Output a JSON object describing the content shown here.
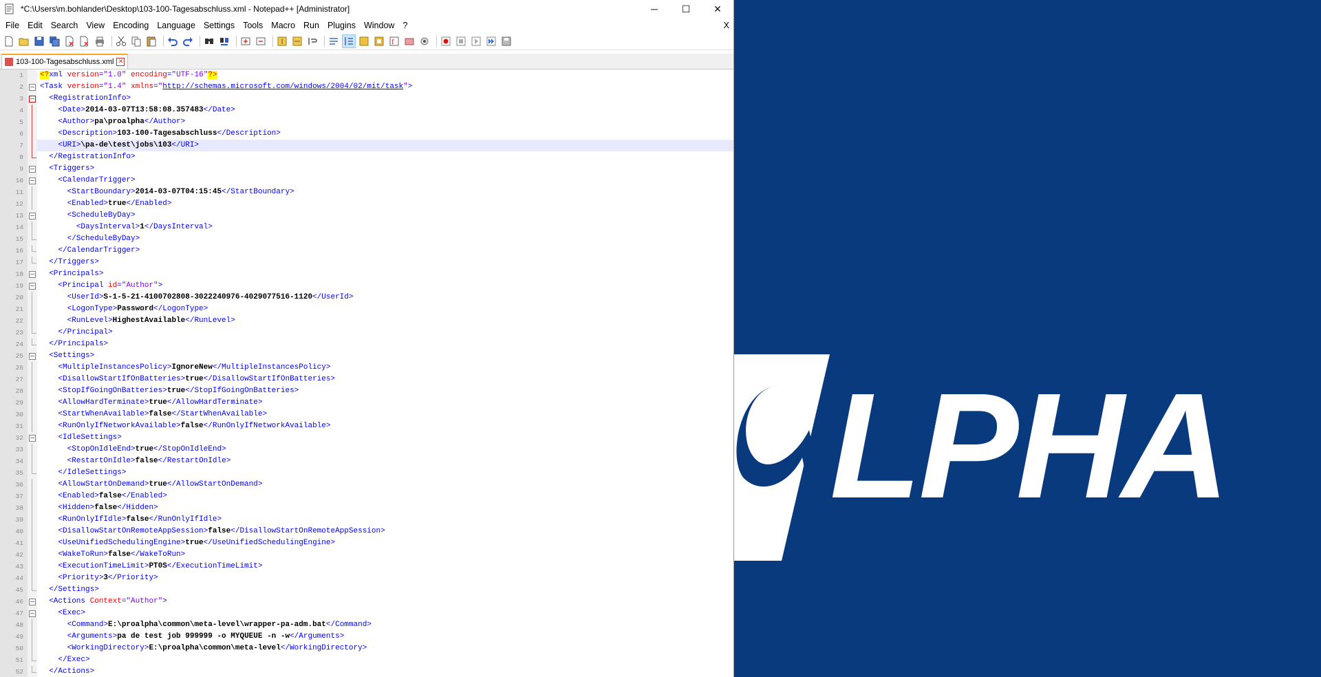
{
  "window": {
    "title": "*C:\\Users\\m.bohlander\\Desktop\\103-100-Tagesabschluss.xml - Notepad++ [Administrator]",
    "minimize": "─",
    "maximize": "☐",
    "close": "✕"
  },
  "menu": {
    "items": [
      "File",
      "Edit",
      "Search",
      "View",
      "Encoding",
      "Language",
      "Settings",
      "Tools",
      "Macro",
      "Run",
      "Plugins",
      "Window",
      "?"
    ],
    "close_doc": "X"
  },
  "tabs": [
    {
      "label": "103-100-Tagesabschluss.xml",
      "close": "✕"
    }
  ],
  "editor": {
    "current_line": 7,
    "lines": [
      {
        "n": "1",
        "fold": "none",
        "segs": [
          [
            "hl",
            "<?"
          ],
          [
            "t",
            "xml "
          ],
          [
            "a",
            "version"
          ],
          [
            "t",
            "="
          ],
          [
            "v",
            "\"1.0\""
          ],
          [
            "t",
            " "
          ],
          [
            "a",
            "encoding"
          ],
          [
            "t",
            "="
          ],
          [
            "v",
            "\"UTF-16\""
          ],
          [
            "hl",
            "?>"
          ]
        ]
      },
      {
        "n": "2",
        "fold": "open",
        "segs": [
          [
            "t",
            "<Task "
          ],
          [
            "a",
            "version"
          ],
          [
            "t",
            "="
          ],
          [
            "v",
            "\"1.4\""
          ],
          [
            "t",
            " "
          ],
          [
            "a",
            "xmlns"
          ],
          [
            "t",
            "="
          ],
          [
            "v",
            "\""
          ],
          [
            "u",
            "http://schemas.microsoft.com/windows/2004/02/mit/task"
          ],
          [
            "v",
            "\""
          ],
          [
            "t",
            ">"
          ]
        ]
      },
      {
        "n": "3",
        "fold": "open-red",
        "segs": [
          [
            "i",
            "  "
          ],
          [
            "t",
            "<RegistrationInfo>"
          ]
        ]
      },
      {
        "n": "4",
        "fold": "line-red",
        "segs": [
          [
            "i",
            "    "
          ],
          [
            "t",
            "<Date>"
          ],
          [
            "x",
            "2014-03-07T13:58:08.357483"
          ],
          [
            "t",
            "</Date>"
          ]
        ]
      },
      {
        "n": "5",
        "fold": "line-red",
        "segs": [
          [
            "i",
            "    "
          ],
          [
            "t",
            "<Author>"
          ],
          [
            "x",
            "pa\\proalpha"
          ],
          [
            "t",
            "</Author>"
          ]
        ]
      },
      {
        "n": "6",
        "fold": "line-red",
        "segs": [
          [
            "i",
            "    "
          ],
          [
            "t",
            "<Description>"
          ],
          [
            "x",
            "103-100-Tagesabschluss"
          ],
          [
            "t",
            "</Description>"
          ]
        ]
      },
      {
        "n": "7",
        "fold": "line-red",
        "segs": [
          [
            "i",
            "    "
          ],
          [
            "t",
            "<URI>"
          ],
          [
            "x",
            "\\pa-de\\test\\jobs\\103"
          ],
          [
            "t",
            "</URI>"
          ]
        ]
      },
      {
        "n": "8",
        "fold": "end-red",
        "segs": [
          [
            "i",
            "  "
          ],
          [
            "t",
            "</RegistrationInfo>"
          ]
        ]
      },
      {
        "n": "9",
        "fold": "open",
        "segs": [
          [
            "i",
            "  "
          ],
          [
            "t",
            "<Triggers>"
          ]
        ]
      },
      {
        "n": "10",
        "fold": "open",
        "segs": [
          [
            "i",
            "    "
          ],
          [
            "t",
            "<CalendarTrigger>"
          ]
        ]
      },
      {
        "n": "11",
        "fold": "line",
        "segs": [
          [
            "i",
            "      "
          ],
          [
            "t",
            "<StartBoundary>"
          ],
          [
            "x",
            "2014-03-07T04:15:45"
          ],
          [
            "t",
            "</StartBoundary>"
          ]
        ]
      },
      {
        "n": "12",
        "fold": "line",
        "segs": [
          [
            "i",
            "      "
          ],
          [
            "t",
            "<Enabled>"
          ],
          [
            "x",
            "true"
          ],
          [
            "t",
            "</Enabled>"
          ]
        ]
      },
      {
        "n": "13",
        "fold": "open",
        "segs": [
          [
            "i",
            "      "
          ],
          [
            "t",
            "<ScheduleByDay>"
          ]
        ]
      },
      {
        "n": "14",
        "fold": "line",
        "segs": [
          [
            "i",
            "        "
          ],
          [
            "t",
            "<DaysInterval>"
          ],
          [
            "x",
            "1"
          ],
          [
            "t",
            "</DaysInterval>"
          ]
        ]
      },
      {
        "n": "15",
        "fold": "end",
        "segs": [
          [
            "i",
            "      "
          ],
          [
            "t",
            "</ScheduleByDay>"
          ]
        ]
      },
      {
        "n": "16",
        "fold": "end",
        "segs": [
          [
            "i",
            "    "
          ],
          [
            "t",
            "</CalendarTrigger>"
          ]
        ]
      },
      {
        "n": "17",
        "fold": "end",
        "segs": [
          [
            "i",
            "  "
          ],
          [
            "t",
            "</Triggers>"
          ]
        ]
      },
      {
        "n": "18",
        "fold": "open",
        "segs": [
          [
            "i",
            "  "
          ],
          [
            "t",
            "<Principals>"
          ]
        ]
      },
      {
        "n": "19",
        "fold": "open",
        "segs": [
          [
            "i",
            "    "
          ],
          [
            "t",
            "<Principal "
          ],
          [
            "a",
            "id"
          ],
          [
            "t",
            "="
          ],
          [
            "v",
            "\"Author\""
          ],
          [
            "t",
            ">"
          ]
        ]
      },
      {
        "n": "20",
        "fold": "line",
        "segs": [
          [
            "i",
            "      "
          ],
          [
            "t",
            "<UserId>"
          ],
          [
            "x",
            "S-1-5-21-4100702808-3022240976-4029077516-1120"
          ],
          [
            "t",
            "</UserId>"
          ]
        ]
      },
      {
        "n": "21",
        "fold": "line",
        "segs": [
          [
            "i",
            "      "
          ],
          [
            "t",
            "<LogonType>"
          ],
          [
            "x",
            "Password"
          ],
          [
            "t",
            "</LogonType>"
          ]
        ]
      },
      {
        "n": "22",
        "fold": "line",
        "segs": [
          [
            "i",
            "      "
          ],
          [
            "t",
            "<RunLevel>"
          ],
          [
            "x",
            "HighestAvailable"
          ],
          [
            "t",
            "</RunLevel>"
          ]
        ]
      },
      {
        "n": "23",
        "fold": "end",
        "segs": [
          [
            "i",
            "    "
          ],
          [
            "t",
            "</Principal>"
          ]
        ]
      },
      {
        "n": "24",
        "fold": "end",
        "segs": [
          [
            "i",
            "  "
          ],
          [
            "t",
            "</Principals>"
          ]
        ]
      },
      {
        "n": "25",
        "fold": "open",
        "segs": [
          [
            "i",
            "  "
          ],
          [
            "t",
            "<Settings>"
          ]
        ]
      },
      {
        "n": "26",
        "fold": "line",
        "segs": [
          [
            "i",
            "    "
          ],
          [
            "t",
            "<MultipleInstancesPolicy>"
          ],
          [
            "x",
            "IgnoreNew"
          ],
          [
            "t",
            "</MultipleInstancesPolicy>"
          ]
        ]
      },
      {
        "n": "27",
        "fold": "line",
        "segs": [
          [
            "i",
            "    "
          ],
          [
            "t",
            "<DisallowStartIfOnBatteries>"
          ],
          [
            "x",
            "true"
          ],
          [
            "t",
            "</DisallowStartIfOnBatteries>"
          ]
        ]
      },
      {
        "n": "28",
        "fold": "line",
        "segs": [
          [
            "i",
            "    "
          ],
          [
            "t",
            "<StopIfGoingOnBatteries>"
          ],
          [
            "x",
            "true"
          ],
          [
            "t",
            "</StopIfGoingOnBatteries>"
          ]
        ]
      },
      {
        "n": "29",
        "fold": "line",
        "segs": [
          [
            "i",
            "    "
          ],
          [
            "t",
            "<AllowHardTerminate>"
          ],
          [
            "x",
            "true"
          ],
          [
            "t",
            "</AllowHardTerminate>"
          ]
        ]
      },
      {
        "n": "30",
        "fold": "line",
        "segs": [
          [
            "i",
            "    "
          ],
          [
            "t",
            "<StartWhenAvailable>"
          ],
          [
            "x",
            "false"
          ],
          [
            "t",
            "</StartWhenAvailable>"
          ]
        ]
      },
      {
        "n": "31",
        "fold": "line",
        "segs": [
          [
            "i",
            "    "
          ],
          [
            "t",
            "<RunOnlyIfNetworkAvailable>"
          ],
          [
            "x",
            "false"
          ],
          [
            "t",
            "</RunOnlyIfNetworkAvailable>"
          ]
        ]
      },
      {
        "n": "32",
        "fold": "open",
        "segs": [
          [
            "i",
            "    "
          ],
          [
            "t",
            "<IdleSettings>"
          ]
        ]
      },
      {
        "n": "33",
        "fold": "line",
        "segs": [
          [
            "i",
            "      "
          ],
          [
            "t",
            "<StopOnIdleEnd>"
          ],
          [
            "x",
            "true"
          ],
          [
            "t",
            "</StopOnIdleEnd>"
          ]
        ]
      },
      {
        "n": "34",
        "fold": "line",
        "segs": [
          [
            "i",
            "      "
          ],
          [
            "t",
            "<RestartOnIdle>"
          ],
          [
            "x",
            "false"
          ],
          [
            "t",
            "</RestartOnIdle>"
          ]
        ]
      },
      {
        "n": "35",
        "fold": "end",
        "segs": [
          [
            "i",
            "    "
          ],
          [
            "t",
            "</IdleSettings>"
          ]
        ]
      },
      {
        "n": "36",
        "fold": "line",
        "segs": [
          [
            "i",
            "    "
          ],
          [
            "t",
            "<AllowStartOnDemand>"
          ],
          [
            "x",
            "true"
          ],
          [
            "t",
            "</AllowStartOnDemand>"
          ]
        ]
      },
      {
        "n": "37",
        "fold": "line",
        "segs": [
          [
            "i",
            "    "
          ],
          [
            "t",
            "<Enabled>"
          ],
          [
            "x",
            "false"
          ],
          [
            "t",
            "</Enabled>"
          ]
        ]
      },
      {
        "n": "38",
        "fold": "line",
        "segs": [
          [
            "i",
            "    "
          ],
          [
            "t",
            "<Hidden>"
          ],
          [
            "x",
            "false"
          ],
          [
            "t",
            "</Hidden>"
          ]
        ]
      },
      {
        "n": "39",
        "fold": "line",
        "segs": [
          [
            "i",
            "    "
          ],
          [
            "t",
            "<RunOnlyIfIdle>"
          ],
          [
            "x",
            "false"
          ],
          [
            "t",
            "</RunOnlyIfIdle>"
          ]
        ]
      },
      {
        "n": "40",
        "fold": "line",
        "segs": [
          [
            "i",
            "    "
          ],
          [
            "t",
            "<DisallowStartOnRemoteAppSession>"
          ],
          [
            "x",
            "false"
          ],
          [
            "t",
            "</DisallowStartOnRemoteAppSession>"
          ]
        ]
      },
      {
        "n": "41",
        "fold": "line",
        "segs": [
          [
            "i",
            "    "
          ],
          [
            "t",
            "<UseUnifiedSchedulingEngine>"
          ],
          [
            "x",
            "true"
          ],
          [
            "t",
            "</UseUnifiedSchedulingEngine>"
          ]
        ]
      },
      {
        "n": "42",
        "fold": "line",
        "segs": [
          [
            "i",
            "    "
          ],
          [
            "t",
            "<WakeToRun>"
          ],
          [
            "x",
            "false"
          ],
          [
            "t",
            "</WakeToRun>"
          ]
        ]
      },
      {
        "n": "43",
        "fold": "line",
        "segs": [
          [
            "i",
            "    "
          ],
          [
            "t",
            "<ExecutionTimeLimit>"
          ],
          [
            "x",
            "PT0S"
          ],
          [
            "t",
            "</ExecutionTimeLimit>"
          ]
        ]
      },
      {
        "n": "44",
        "fold": "line",
        "segs": [
          [
            "i",
            "    "
          ],
          [
            "t",
            "<Priority>"
          ],
          [
            "x",
            "3"
          ],
          [
            "t",
            "</Priority>"
          ]
        ]
      },
      {
        "n": "45",
        "fold": "end",
        "segs": [
          [
            "i",
            "  "
          ],
          [
            "t",
            "</Settings>"
          ]
        ]
      },
      {
        "n": "46",
        "fold": "open",
        "segs": [
          [
            "i",
            "  "
          ],
          [
            "t",
            "<Actions "
          ],
          [
            "a",
            "Context"
          ],
          [
            "t",
            "="
          ],
          [
            "v",
            "\"Author\""
          ],
          [
            "t",
            ">"
          ]
        ]
      },
      {
        "n": "47",
        "fold": "open",
        "segs": [
          [
            "i",
            "    "
          ],
          [
            "t",
            "<Exec>"
          ]
        ]
      },
      {
        "n": "48",
        "fold": "line",
        "segs": [
          [
            "i",
            "      "
          ],
          [
            "t",
            "<Command>"
          ],
          [
            "x",
            "E:\\proalpha\\common\\meta-level\\wrapper-pa-adm.bat"
          ],
          [
            "t",
            "</Command>"
          ]
        ]
      },
      {
        "n": "49",
        "fold": "line",
        "segs": [
          [
            "i",
            "      "
          ],
          [
            "t",
            "<Arguments>"
          ],
          [
            "x",
            "pa de test job 999999 -o MYQUEUE -n -w"
          ],
          [
            "t",
            "</Arguments>"
          ]
        ]
      },
      {
        "n": "50",
        "fold": "line",
        "segs": [
          [
            "i",
            "      "
          ],
          [
            "t",
            "<WorkingDirectory>"
          ],
          [
            "x",
            "E:\\proalpha\\common\\meta-level"
          ],
          [
            "t",
            "</WorkingDirectory>"
          ]
        ]
      },
      {
        "n": "51",
        "fold": "end",
        "segs": [
          [
            "i",
            "    "
          ],
          [
            "t",
            "</Exec>"
          ]
        ]
      },
      {
        "n": "52",
        "fold": "end",
        "segs": [
          [
            "i",
            "  "
          ],
          [
            "t",
            "</Actions>"
          ]
        ]
      }
    ]
  },
  "background": {
    "color": "#0a3a7e",
    "logo_text": "LPHA"
  }
}
